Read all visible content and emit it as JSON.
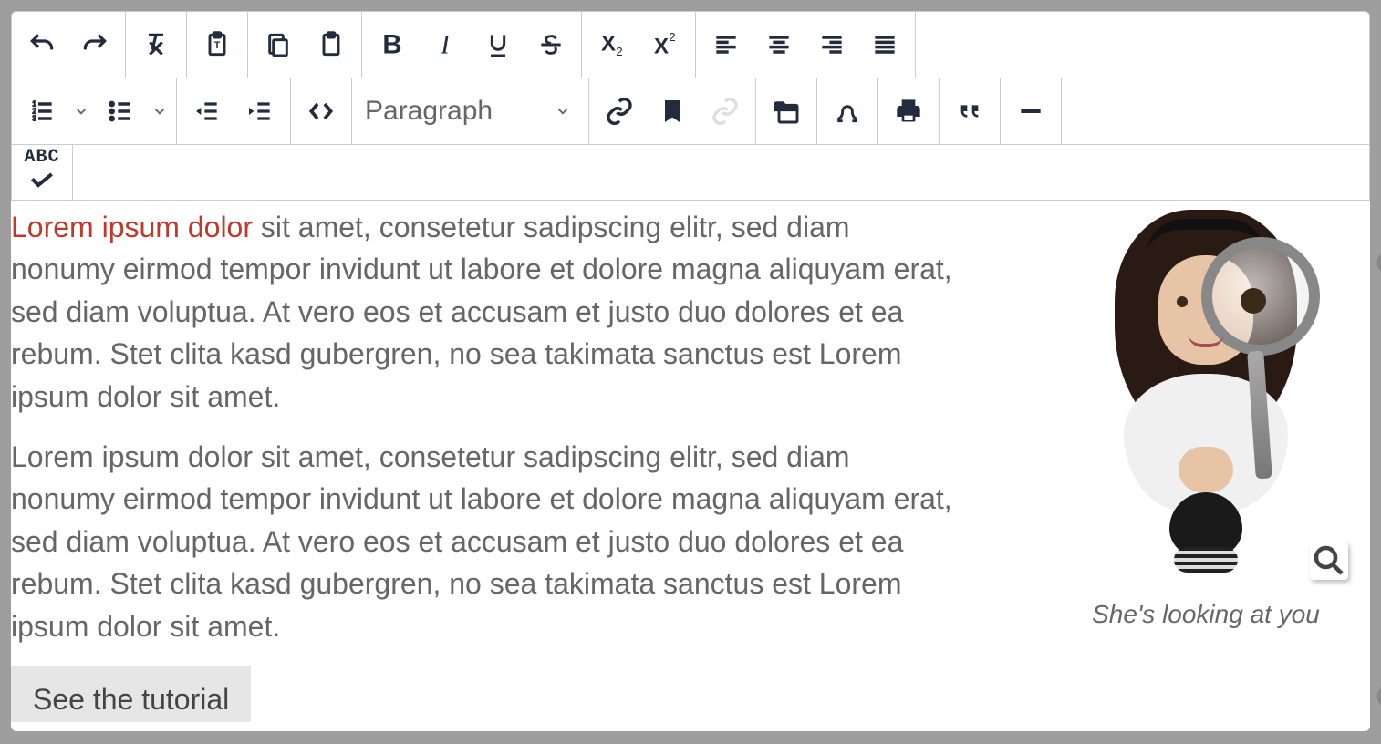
{
  "toolbar": {
    "format_label": "Paragraph",
    "spellcheck_label": "ABC"
  },
  "content": {
    "link_text": "Lorem ipsum dolor",
    "p1_rest": " sit amet, consetetur sadipscing elitr, sed diam nonumy eirmod tempor invidunt ut labore et dolore magna aliquyam erat, sed diam voluptua. At vero eos et accusam et justo duo dolores et ea rebum. Stet clita kasd gubergren, no sea takimata sanctus est Lorem ipsum dolor sit amet.",
    "p2": "Lorem ipsum dolor sit amet, consetetur sadipscing elitr, sed diam nonumy eirmod tempor invidunt ut labore et dolore magna aliquyam erat, sed diam voluptua. At vero eos et accusam et justo duo dolores et ea rebum. Stet clita kasd gubergren, no sea takimata sanctus est Lorem ipsum dolor sit amet.",
    "caption": "She's looking at you",
    "tutorial_button": "See the tutorial"
  },
  "icons": {
    "undo": "undo-icon",
    "redo": "redo-icon",
    "clear_format": "clear-format-icon",
    "paste_text": "paste-text-icon",
    "copy": "copy-icon",
    "paste": "paste-icon",
    "bold": "bold-icon",
    "italic": "italic-icon",
    "underline": "underline-icon",
    "strike": "strikethrough-icon",
    "subscript": "subscript-icon",
    "superscript": "superscript-icon",
    "align_left": "align-left-icon",
    "align_center": "align-center-icon",
    "align_right": "align-right-icon",
    "justify": "justify-icon",
    "ordered_list": "ordered-list-icon",
    "unordered_list": "unordered-list-icon",
    "outdent": "outdent-icon",
    "indent": "indent-icon",
    "container": "container-icon",
    "link": "link-icon",
    "bookmark": "bookmark-icon",
    "unlink": "unlink-icon",
    "filebrowser": "filebrowser-icon",
    "specialchar": "special-character-icon",
    "print": "print-icon",
    "blockquote": "blockquote-icon",
    "hr": "horizontal-rule-icon",
    "spellcheck": "spellcheck-icon",
    "zoom": "zoom-icon",
    "handle": "drag-handle-icon"
  }
}
